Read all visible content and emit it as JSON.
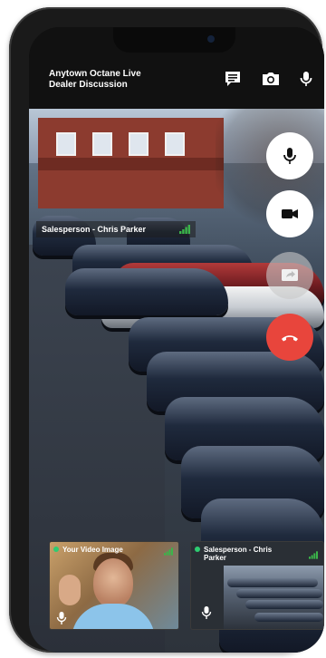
{
  "header": {
    "title_line1": "Anytown Octane Live",
    "title_line2": "Dealer Discussion",
    "icons": [
      "chat-icon",
      "camera-flip-icon",
      "microphone-icon"
    ]
  },
  "main_video": {
    "participant_label": "Salesperson - Chris Parker",
    "signal_icon": "signal-bars-icon"
  },
  "controls": {
    "items": [
      {
        "name": "mute-button",
        "icon": "microphone-icon",
        "state": "white"
      },
      {
        "name": "video-button",
        "icon": "video-camera-icon",
        "state": "white"
      },
      {
        "name": "share-screen-button",
        "icon": "screen-share-icon",
        "state": "grey"
      },
      {
        "name": "end-call-button",
        "icon": "phone-hangup-icon",
        "state": "red"
      }
    ],
    "colors": {
      "end_call": "#e8453c",
      "active": "#ffffff",
      "disabled": "#c8c8c8",
      "status_dot": "#2ecc71"
    }
  },
  "thumbnails": [
    {
      "label": "Your Video Image"
    },
    {
      "label": "Salesperson - Chris Parker"
    }
  ]
}
